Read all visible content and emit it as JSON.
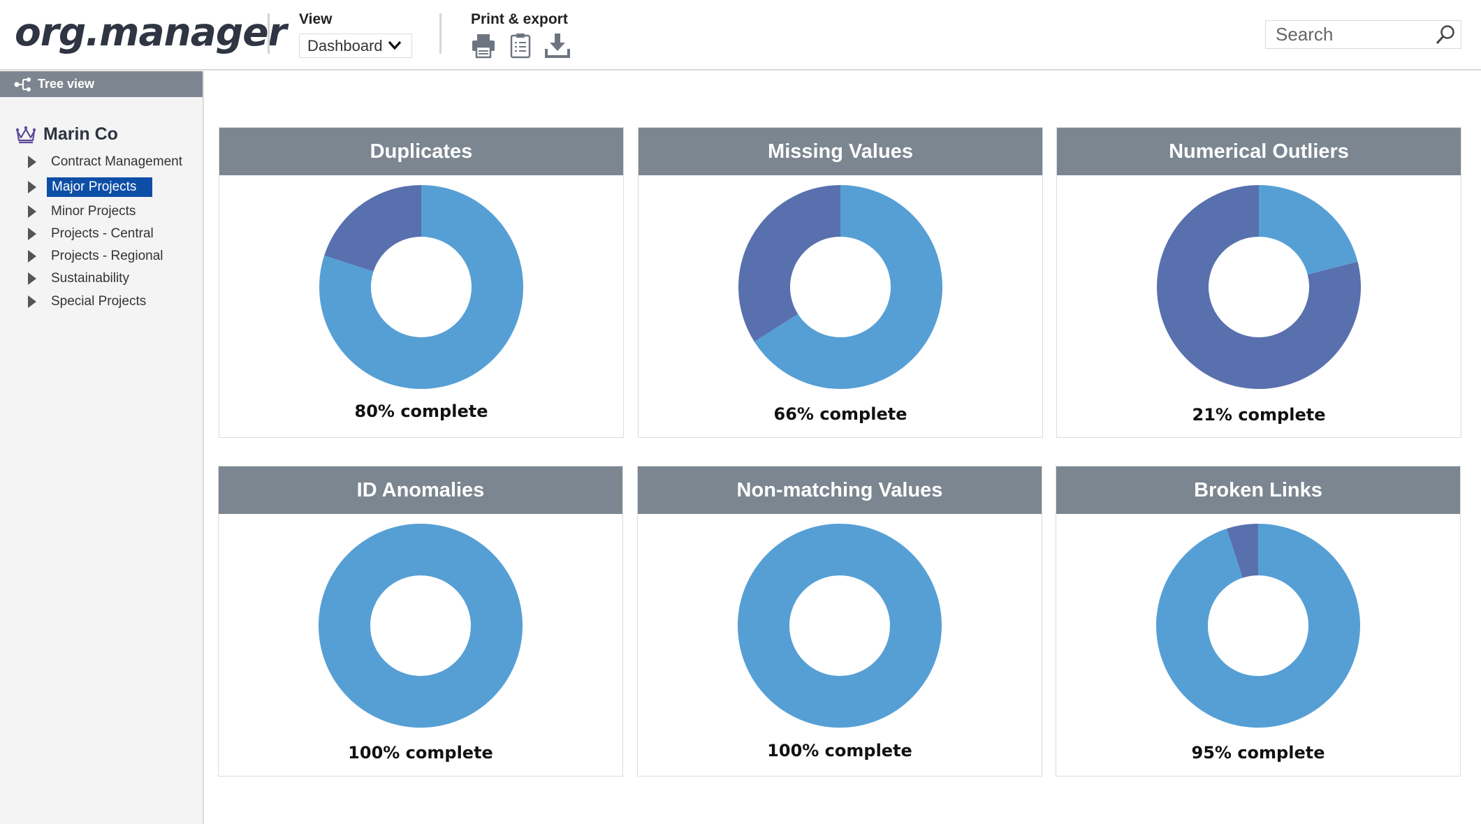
{
  "header": {
    "logo": "org.manager",
    "view": {
      "label": "View",
      "selected": "Dashboard"
    },
    "print_export": {
      "label": "Print & export",
      "icons": [
        "printer-icon",
        "clipboard-icon",
        "download-icon"
      ]
    },
    "search": {
      "placeholder": "Search"
    }
  },
  "sidebar": {
    "tab_label": "Tree view",
    "org_name": "Marin Co",
    "items": [
      {
        "label": "Contract Management",
        "selected": false
      },
      {
        "label": "Major Projects",
        "selected": true
      },
      {
        "label": "Minor Projects",
        "selected": false
      },
      {
        "label": "Projects - Central",
        "selected": false
      },
      {
        "label": "Projects - Regional",
        "selected": false
      },
      {
        "label": "Sustainability",
        "selected": false
      },
      {
        "label": "Special Projects",
        "selected": false
      }
    ]
  },
  "colors": {
    "complete": "#569fd5",
    "remaining": "#5870ad",
    "card_header": "#7b8691",
    "selected": "#0d4ea6"
  },
  "cards": [
    {
      "title": "Duplicates",
      "percent": 80,
      "caption": "80% complete"
    },
    {
      "title": "Missing Values",
      "percent": 66,
      "caption": "66% complete"
    },
    {
      "title": "Numerical Outliers",
      "percent": 21,
      "caption": "21% complete"
    },
    {
      "title": "ID Anomalies",
      "percent": 100,
      "caption": "100% complete"
    },
    {
      "title": "Non-matching Values",
      "percent": 100,
      "caption": "100% complete"
    },
    {
      "title": "Broken Links",
      "percent": 95,
      "caption": "95% complete"
    }
  ]
}
